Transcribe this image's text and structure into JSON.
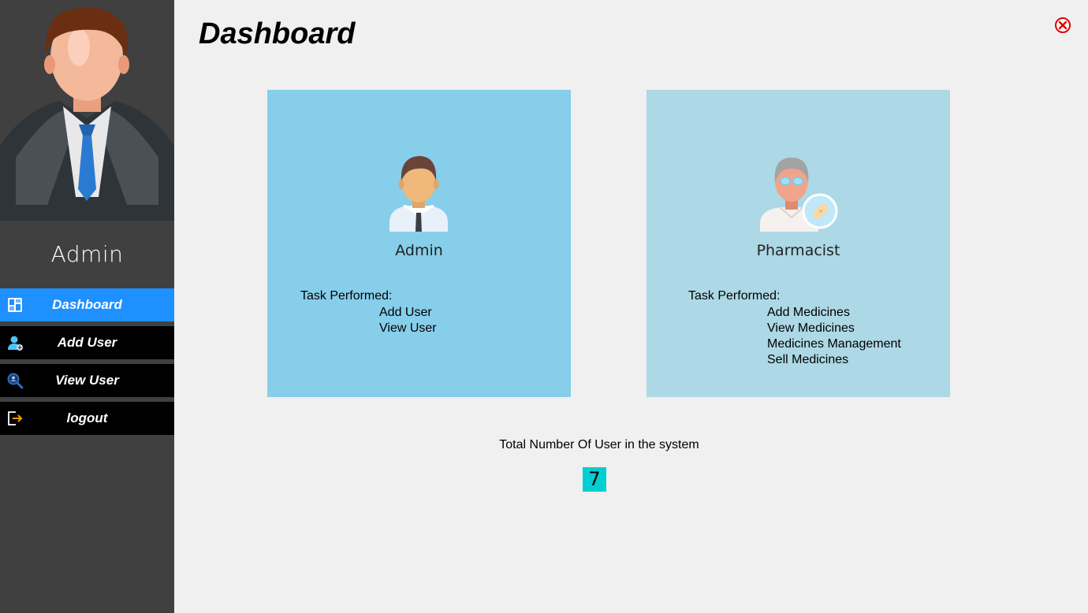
{
  "sidebar": {
    "user_name": "Admin",
    "items": [
      {
        "label": "Dashboard",
        "icon": "dashboard-icon",
        "active": true
      },
      {
        "label": "Add User",
        "icon": "add-user-icon",
        "active": false
      },
      {
        "label": "View User",
        "icon": "view-user-icon",
        "active": false
      },
      {
        "label": "logout",
        "icon": "logout-icon",
        "active": false
      }
    ]
  },
  "header": {
    "title": "Dashboard",
    "close_icon": "close-icon"
  },
  "cards": [
    {
      "role": "Admin",
      "task_heading": "Task Performed:",
      "tasks": [
        "Add User",
        "View User"
      ],
      "color": "#87ceeb"
    },
    {
      "role": "Pharmacist",
      "task_heading": "Task Performed:",
      "tasks": [
        "Add Medicines",
        "View Medicines",
        "Medicines Management",
        "Sell Medicines"
      ],
      "color": "#add8e6"
    }
  ],
  "stats": {
    "label": "Total Number Of User in the system",
    "total_users": "7"
  },
  "colors": {
    "sidebar_bg": "#404040",
    "active_nav": "#1e90ff",
    "nav_bg": "#000000",
    "count_bg": "#00ced1"
  }
}
